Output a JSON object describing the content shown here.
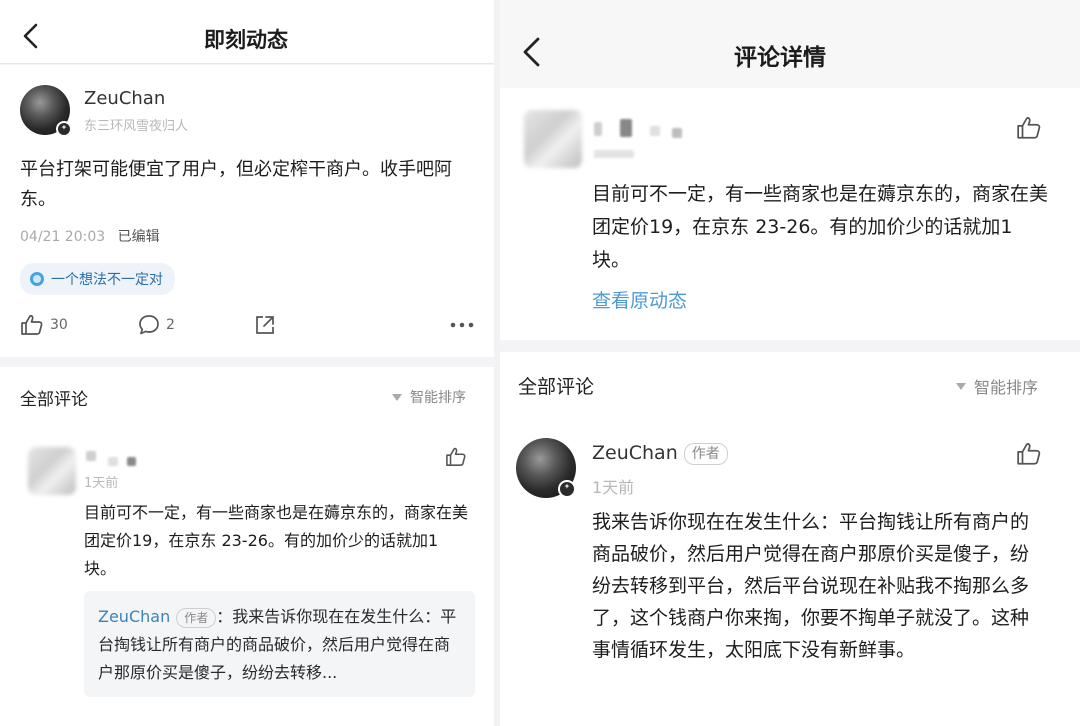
{
  "left": {
    "header": {
      "title": "即刻动态"
    },
    "post": {
      "author": "ZeuChan",
      "signature": "东三环风雪夜归人",
      "text": "平台打架可能便宜了用户，但必定榨干商户。收手吧阿东。",
      "time": "04/21 20:03",
      "edited": "已编辑",
      "topic": "一个想法不一定对",
      "actions": {
        "likes": "30",
        "comments": "2"
      }
    },
    "comments_section": {
      "title": "全部评论",
      "sort": "智能排序"
    },
    "comment": {
      "time": "1天前",
      "text": "目前可不一定，有一些商家也是在薅京东的，商家在美团定价19，在京东 23-26。有的加价少的话就加1块。",
      "reply": {
        "name": "ZeuChan",
        "tag": "作者",
        "text": "：我来告诉你现在在发生什么：平台掏钱让所有商户的商品破价，然后用户觉得在商户那原价买是傻子，纷纷去转移..."
      }
    }
  },
  "right": {
    "header": {
      "title": "评论详情"
    },
    "comment": {
      "time": "1天前",
      "text": "目前可不一定，有一些商家也是在薅京东的，商家在美团定价19，在京东 23-26。有的加价少的话就加1块。",
      "view_original": "查看原动态"
    },
    "comments_section": {
      "title": "全部评论",
      "sort": "智能排序"
    },
    "reply": {
      "author": "ZeuChan",
      "tag": "作者",
      "time": "1天前",
      "text": "我来告诉你现在在发生什么：平台掏钱让所有商户的商品破价，然后用户觉得在商户那原价买是傻子，纷纷去转移到平台，然后平台说现在补贴我不掏那么多了，这个钱商户你来掏，你要不掏单子就没了。这种事情循环发生，太阳底下没有新鲜事。"
    }
  },
  "colors": {
    "link_blue": "#4f9ad3",
    "reply_name_blue": "#3b83b9",
    "topic_blue": "#45a4e0",
    "page_bg": "#f4f4f6"
  },
  "icons": [
    "back-icon",
    "like-icon",
    "comment-icon",
    "share-icon",
    "more-icon",
    "sort-icon",
    "topic-icon"
  ]
}
